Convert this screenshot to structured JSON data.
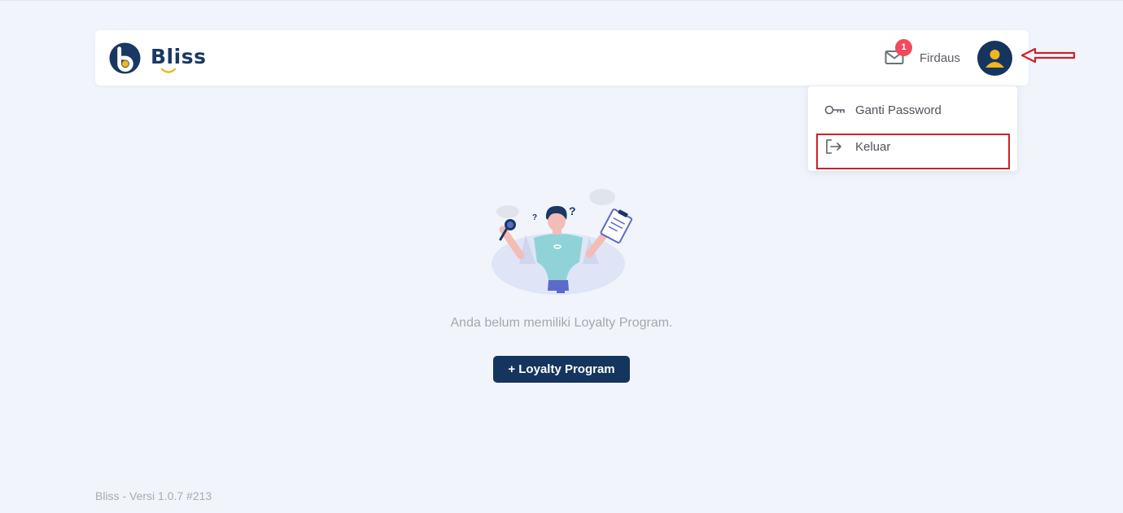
{
  "app": {
    "brand": "Bliss",
    "brand_color": "#193863",
    "accent_color": "#f2b51c"
  },
  "header": {
    "notifications": {
      "icon": "mail-icon",
      "count": "1"
    },
    "user_name": "Firdaus",
    "avatar_icon": "user-avatar-icon"
  },
  "user_menu": {
    "items": [
      {
        "label": "Ganti Password",
        "icon": "key-icon"
      },
      {
        "label": "Keluar",
        "icon": "logout-icon"
      }
    ]
  },
  "annotations": {
    "highlight_color": "#d0202b",
    "arrow_icon": "left-arrow-icon"
  },
  "main": {
    "empty_message": "Anda belum memiliki Loyalty Program.",
    "add_button_label": "+ Loyalty Program",
    "illustration": "confused-person-illustration"
  },
  "footer": {
    "version_text": "Bliss - Versi 1.0.7 #213"
  }
}
